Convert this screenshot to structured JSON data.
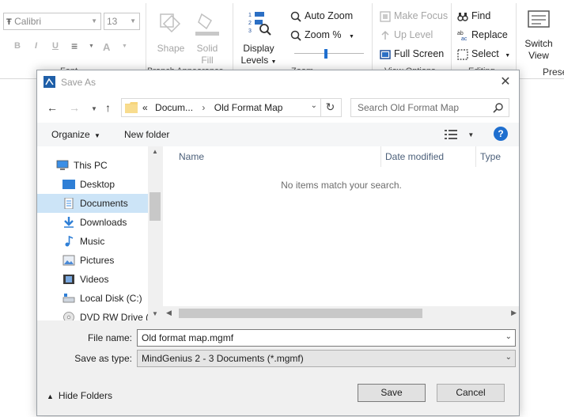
{
  "ribbon": {
    "font_name": "Calibri",
    "font_size": "13",
    "groups": [
      {
        "label": "Font"
      },
      {
        "label": "Branch Appearance"
      },
      {
        "label": "Zoom"
      },
      {
        "label": "View Options"
      },
      {
        "label": "Editing"
      },
      {
        "label": "Present"
      }
    ],
    "format_bold": "B",
    "format_italic": "I",
    "format_underline": "U",
    "shape_label": "Shape",
    "solid_fill_label_1": "Solid",
    "solid_fill_label_2": "Fill",
    "display_levels_1": "Display",
    "display_levels_2": "Levels",
    "auto_zoom": "Auto Zoom",
    "zoom_pct": "Zoom %",
    "zoom_slider_value": 0.45,
    "make_focus": "Make Focus",
    "up_level": "Up Level",
    "full_screen": "Full Screen",
    "find": "Find",
    "replace": "Replace",
    "select": "Select",
    "switch_view_1": "Switch",
    "switch_view_2": "View",
    "present": "Prese"
  },
  "dialog": {
    "title": "Save As",
    "breadcrumb_prefix": "«",
    "breadcrumb": [
      "Docum...",
      "Old Format Map"
    ],
    "search_placeholder": "Search Old Format Map",
    "organize": "Organize",
    "new_folder": "New folder",
    "help": "?",
    "nav_items": [
      {
        "label": "This PC",
        "icon": "pc-icon"
      },
      {
        "label": "Desktop",
        "icon": "desktop-icon"
      },
      {
        "label": "Documents",
        "icon": "documents-icon",
        "selected": true
      },
      {
        "label": "Downloads",
        "icon": "downloads-icon"
      },
      {
        "label": "Music",
        "icon": "music-icon"
      },
      {
        "label": "Pictures",
        "icon": "pictures-icon"
      },
      {
        "label": "Videos",
        "icon": "videos-icon"
      },
      {
        "label": "Local Disk (C:)",
        "icon": "disk-icon"
      },
      {
        "label": "DVD RW Drive (D",
        "icon": "dvd-icon"
      }
    ],
    "columns": [
      "Name",
      "Date modified",
      "Type"
    ],
    "empty_message": "No items match your search.",
    "file_name_label": "File name:",
    "file_name_value": "Old format map.mgmf",
    "save_type_label": "Save as type:",
    "save_type_value": "MindGenius 2 - 3 Documents (*.mgmf)",
    "hide_folders": "Hide Folders",
    "save_button": "Save",
    "cancel_button": "Cancel"
  },
  "colors": {
    "accent": "#1f6fcf",
    "selected_bg": "#cce4f7",
    "dialog_bg": "#f0f0f0"
  }
}
